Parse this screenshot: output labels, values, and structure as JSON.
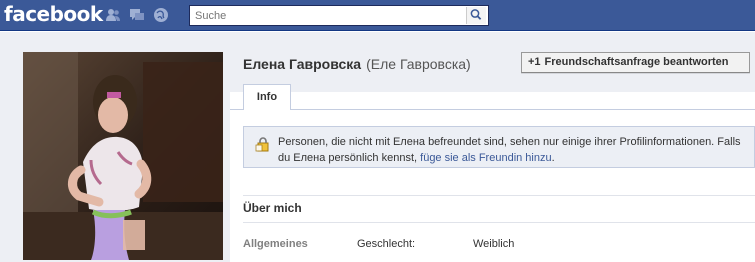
{
  "header": {
    "logo": "facebook",
    "search_placeholder": "Suche",
    "icons": [
      "friend-requests-icon",
      "messages-icon",
      "notifications-icon",
      "search-icon"
    ]
  },
  "profile": {
    "name": "Елена Гавровска",
    "alt_name": "(Еле Гавровска)",
    "reply_button": "Freundschaftsanfrage beantworten",
    "reply_button_icon": "+1"
  },
  "tabs": [
    {
      "label": "Info"
    }
  ],
  "notice": {
    "text": "Personen, die nicht mit Елена befreundet sind, sehen nur einige ihrer Profilinformationen. Falls du Елена persönlich kennst, ",
    "link": "füge sie als Freundin hinzu",
    "suffix": "."
  },
  "about": {
    "heading": "Über mich",
    "rows": [
      {
        "section": "Allgemeines",
        "key": "Geschlecht:",
        "value": "Weiblich"
      }
    ]
  },
  "colors": {
    "brand_blue": "#3b5998",
    "page_bg": "#edeff4",
    "link": "#3b5998"
  }
}
